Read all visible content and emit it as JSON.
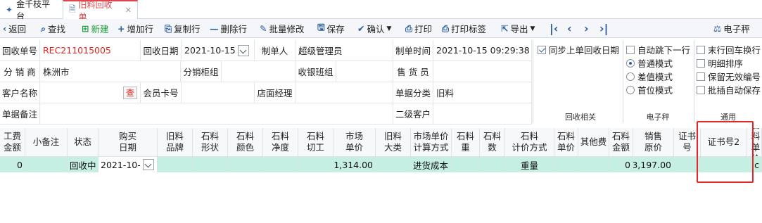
{
  "tabs": [
    {
      "label": "金千枝平台",
      "icon": "app-logo-icon"
    },
    {
      "label": "旧料回收单",
      "icon": "document-icon"
    }
  ],
  "toolbar": {
    "back": "返回",
    "search": "查找",
    "new": "新建",
    "add_row": "增加行",
    "copy_row": "复制行",
    "delete_row": "删除行",
    "batch_edit": "批量修改",
    "save": "保存",
    "confirm": "确认",
    "print": "打印",
    "print_label": "打印标签",
    "export": "导出",
    "scale": "电子秤"
  },
  "form": {
    "recycle_no_label": "回收单号",
    "recycle_no": "REC211015005",
    "recycle_date_label": "回收日期",
    "recycle_date": "2021-10-15",
    "maker_label": "制单人",
    "maker": "超级管理员",
    "make_time_label": "制单时间",
    "make_time": "2021-10-15 09:29:38",
    "branch_label": "分 销 商",
    "branch": "株洲市",
    "counter_label": "分销柜组",
    "counter": "",
    "cashier_label": "收银班组",
    "cashier": "",
    "salesman_label": "售 货 员",
    "salesman": "",
    "customer_label": "客户名称",
    "customer": "",
    "query_btn": "查",
    "member_label": "会员卡号",
    "member": "",
    "manager_label": "店面经理",
    "manager": "",
    "category_label": "单据分类",
    "category": "旧料",
    "remark_label": "单据备注",
    "remark": "",
    "sub_customer_label": "二级客户",
    "sub_customer": ""
  },
  "options": {
    "sync_date": "同步上单回收日期",
    "auto_next": "自动跳下一行",
    "normal_mode": "普通模式",
    "diff_mode": "差值模式",
    "first_mode": "首位模式",
    "last_row_enter": "末行回车换行",
    "detail_sort": "明细排序",
    "keep_invalid": "保留无效编号",
    "batch_insert_save": "批插自动保存",
    "group_recycle": "回收相关",
    "group_scale": "电子秤",
    "group_general": "通用"
  },
  "grid": {
    "headers": [
      "工费\n金额",
      "小备注",
      "状态",
      "购买\n日期",
      "旧料\n品牌",
      "石料\n形状",
      "石料\n颜色",
      "石料\n净度",
      "石料\n切工",
      "市场\n单价",
      "旧料\n大类",
      "市场单价\n计算方式",
      "石料\n重",
      "石料\n数",
      "石料\n计价方式",
      "石料\n单价",
      "其他费",
      "石料\n金额",
      "销售\n原价",
      "证书号",
      "证书号2",
      "石料\n单价"
    ],
    "row": [
      "0",
      "",
      "回收中",
      "2021-10-",
      "",
      "",
      "",
      "",
      "",
      "1,314.00",
      "",
      "进货成本",
      "",
      "",
      "重量",
      "",
      "",
      "0",
      "3,197.00",
      "",
      "",
      "c"
    ]
  }
}
